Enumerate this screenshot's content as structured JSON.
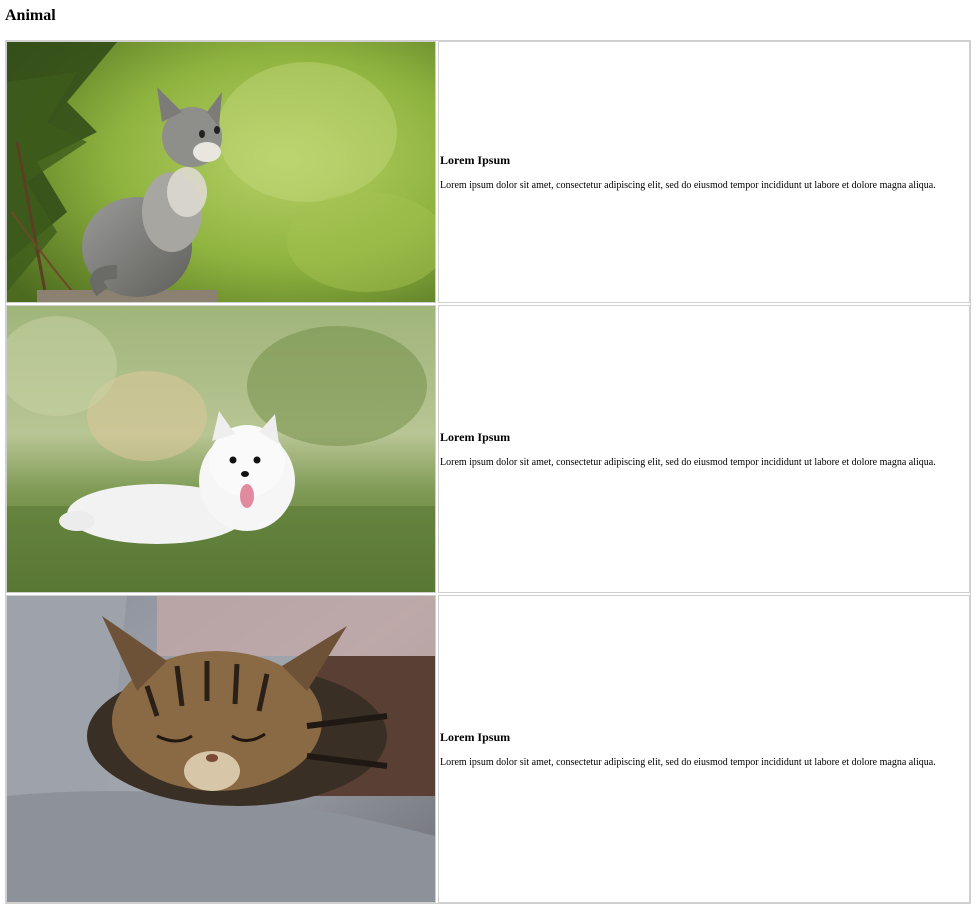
{
  "page": {
    "title": "Animal"
  },
  "cards": [
    {
      "image": "kitten-on-branch-photo",
      "heading": "Lorem Ipsum",
      "text": "Lorem ipsum dolor sit amet, consectetur adipiscing elit, sed do eiusmod tempor incididunt ut labore et dolore magna aliqua."
    },
    {
      "image": "white-puppy-on-grass-photo",
      "heading": "Lorem Ipsum",
      "text": "Lorem ipsum dolor sit amet, consectetur adipiscing elit, sed do eiusmod tempor incididunt ut labore et dolore magna aliqua."
    },
    {
      "image": "sleeping-tabby-cat-photo",
      "heading": "Lorem Ipsum",
      "text": "Lorem ipsum dolor sit amet, consectetur adipiscing elit, sed do eiusmod tempor incididunt ut labore et dolore magna aliqua."
    }
  ],
  "colors": {
    "cell_border": "#cfcfcf",
    "background": "#ffffff",
    "text": "#000000"
  }
}
